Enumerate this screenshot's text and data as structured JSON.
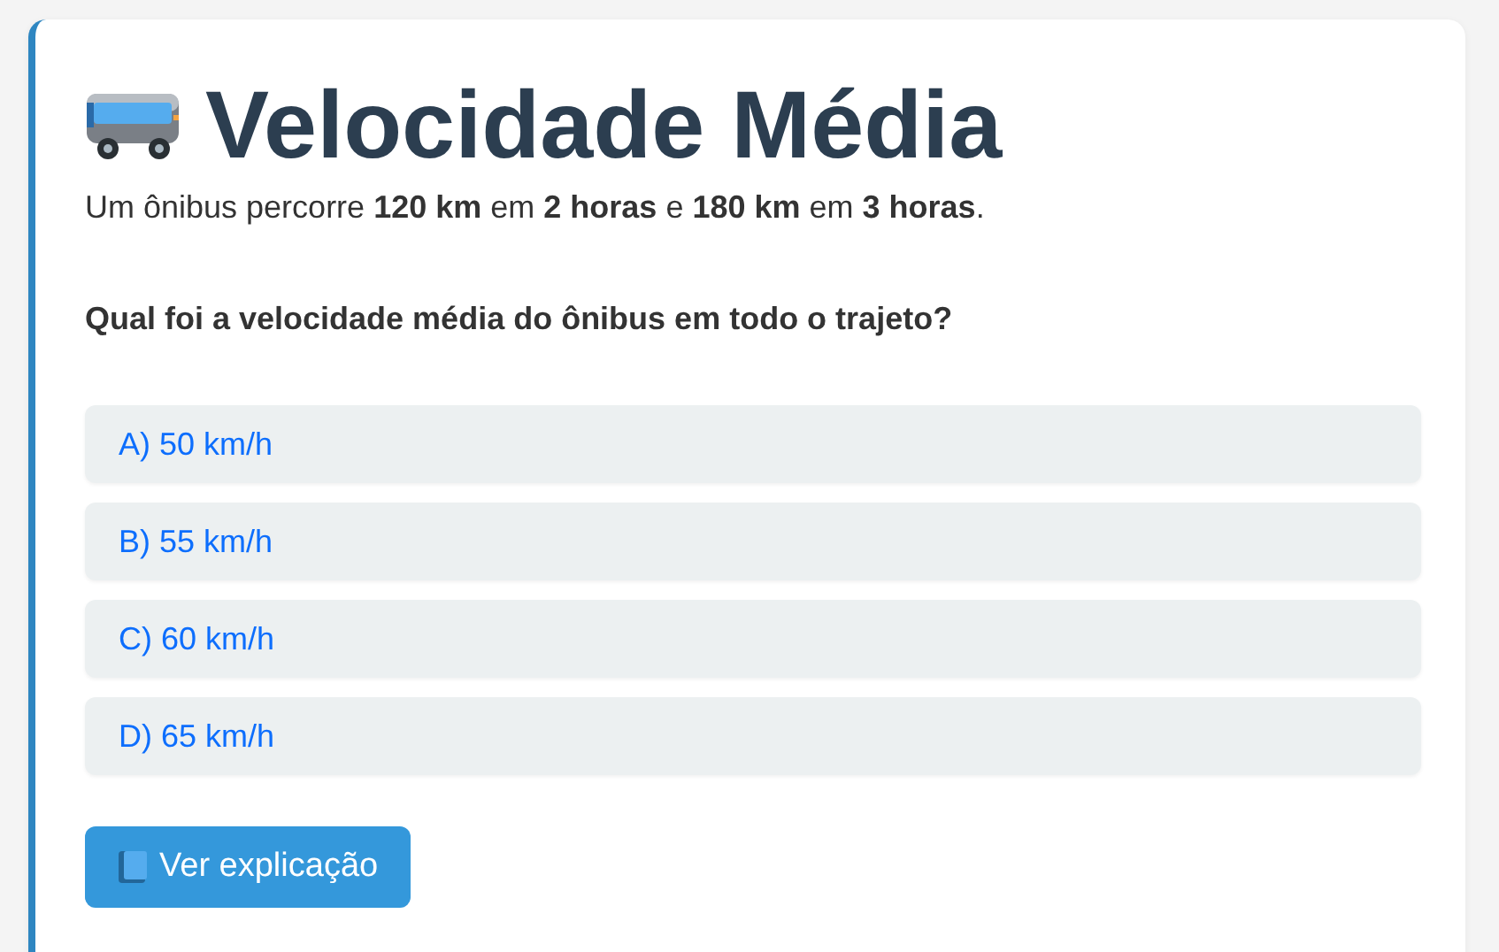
{
  "title": "Velocidade Média",
  "statement": "Um ônibus percorre **120 km** em **2 horas** e **180 km** em **3 horas**.",
  "question": "Qual foi a velocidade média do ônibus em todo o trajeto?",
  "options": [
    {
      "label": "A) 50 km/h"
    },
    {
      "label": "B) 55 km/h"
    },
    {
      "label": "C) 60 km/h"
    },
    {
      "label": "D) 65 km/h"
    }
  ],
  "explain_button": "Ver explicação"
}
